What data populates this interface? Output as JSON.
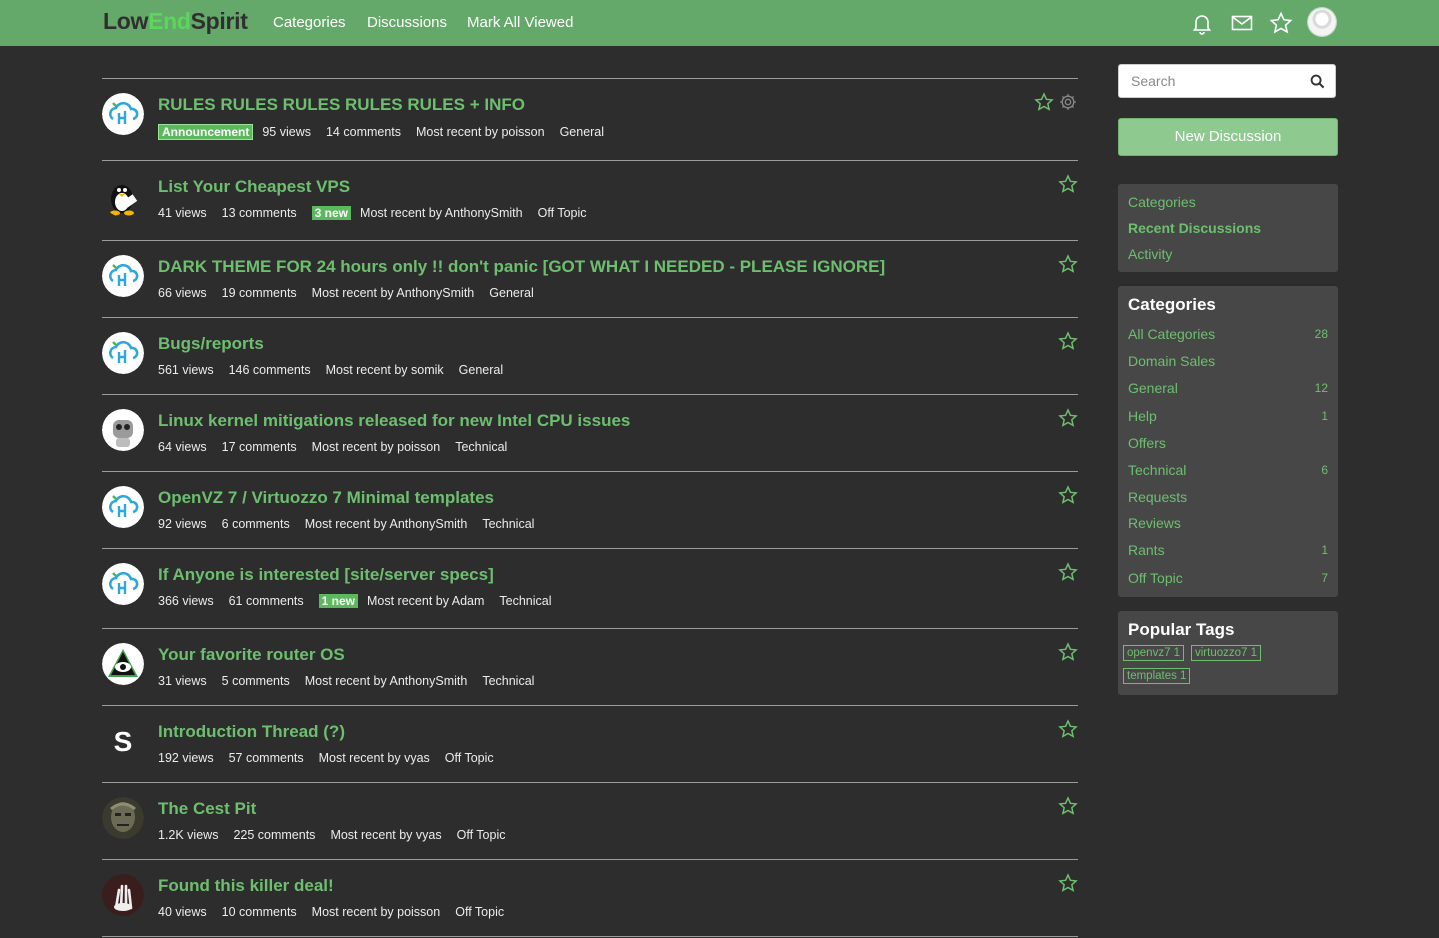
{
  "header": {
    "logo": {
      "part1": "Low",
      "part2": "End",
      "part3": "Spirit"
    },
    "nav": [
      "Categories",
      "Discussions",
      "Mark All Viewed"
    ],
    "icons": [
      "bell-icon",
      "envelope-icon",
      "star-icon",
      "user-avatar"
    ]
  },
  "colors": {
    "brand": "#64a86a",
    "accent": "#6dbf6f",
    "new_badge": "#5cb85c",
    "background": "#2d2d2d"
  },
  "discussions": [
    {
      "title": "RULES RULES RULES RULES RULES + INFO",
      "badge": "Announcement",
      "views": "95 views",
      "comments": "14 comments",
      "new": "",
      "recent": "Most recent by poisson",
      "category": "General",
      "avatar": "cloud-logo"
    },
    {
      "title": "List Your Cheapest VPS",
      "badge": "",
      "views": "41 views",
      "comments": "13 comments",
      "new": "3 new",
      "recent": "Most recent by AnthonySmith",
      "category": "Off Topic",
      "avatar": "penguin"
    },
    {
      "title": "DARK THEME FOR 24 hours only !! don't panic [GOT WHAT I NEEDED - PLEASE IGNORE]",
      "badge": "",
      "views": "66 views",
      "comments": "19 comments",
      "new": "",
      "recent": "Most recent by AnthonySmith",
      "category": "General",
      "avatar": "cloud-logo"
    },
    {
      "title": "Bugs/reports",
      "badge": "",
      "views": "561 views",
      "comments": "146 comments",
      "new": "",
      "recent": "Most recent by somik",
      "category": "General",
      "avatar": "cloud-logo"
    },
    {
      "title": "Linux kernel mitigations released for new Intel CPU issues",
      "badge": "",
      "views": "64 views",
      "comments": "17 comments",
      "new": "",
      "recent": "Most recent by poisson",
      "category": "Technical",
      "avatar": "robot"
    },
    {
      "title": "OpenVZ 7 / Virtuozzo 7 Minimal templates",
      "badge": "",
      "views": "92 views",
      "comments": "6 comments",
      "new": "",
      "recent": "Most recent by AnthonySmith",
      "category": "Technical",
      "avatar": "cloud-logo"
    },
    {
      "title": "If Anyone is interested [site/server specs]",
      "badge": "",
      "views": "366 views",
      "comments": "61 comments",
      "new": "1 new",
      "recent": "Most recent by Adam",
      "category": "Technical",
      "avatar": "cloud-logo"
    },
    {
      "title": "Your favorite router OS",
      "badge": "",
      "views": "31 views",
      "comments": "5 comments",
      "new": "",
      "recent": "Most recent by AnthonySmith",
      "category": "Technical",
      "avatar": "eye-triangle"
    },
    {
      "title": "Introduction Thread (?)",
      "badge": "",
      "views": "192 views",
      "comments": "57 comments",
      "new": "",
      "recent": "Most recent by vyas",
      "category": "Off Topic",
      "avatar": "letter-s"
    },
    {
      "title": "The Cest Pit",
      "badge": "",
      "views": "1.2K views",
      "comments": "225 comments",
      "new": "",
      "recent": "Most recent by vyas",
      "category": "Off Topic",
      "avatar": "statue"
    },
    {
      "title": "Found this killer deal!",
      "badge": "",
      "views": "40 views",
      "comments": "10 comments",
      "new": "",
      "recent": "Most recent by poisson",
      "category": "Off Topic",
      "avatar": "skeleton"
    }
  ],
  "sidebar": {
    "search_placeholder": "Search",
    "new_discussion": "New Discussion",
    "nav": [
      "Categories",
      "Recent Discussions",
      "Activity"
    ],
    "categories_title": "Categories",
    "categories": [
      {
        "name": "All Categories",
        "count": "28"
      },
      {
        "name": "Domain Sales",
        "count": ""
      },
      {
        "name": "General",
        "count": "12"
      },
      {
        "name": "Help",
        "count": "1"
      },
      {
        "name": "Offers",
        "count": ""
      },
      {
        "name": "Technical",
        "count": "6"
      },
      {
        "name": "Requests",
        "count": ""
      },
      {
        "name": "Reviews",
        "count": ""
      },
      {
        "name": "Rants",
        "count": "1"
      },
      {
        "name": "Off Topic",
        "count": "7"
      }
    ],
    "tags_title": "Popular Tags",
    "tags": [
      "openvz7 1",
      "virtuozzo7 1",
      "templates 1"
    ]
  }
}
